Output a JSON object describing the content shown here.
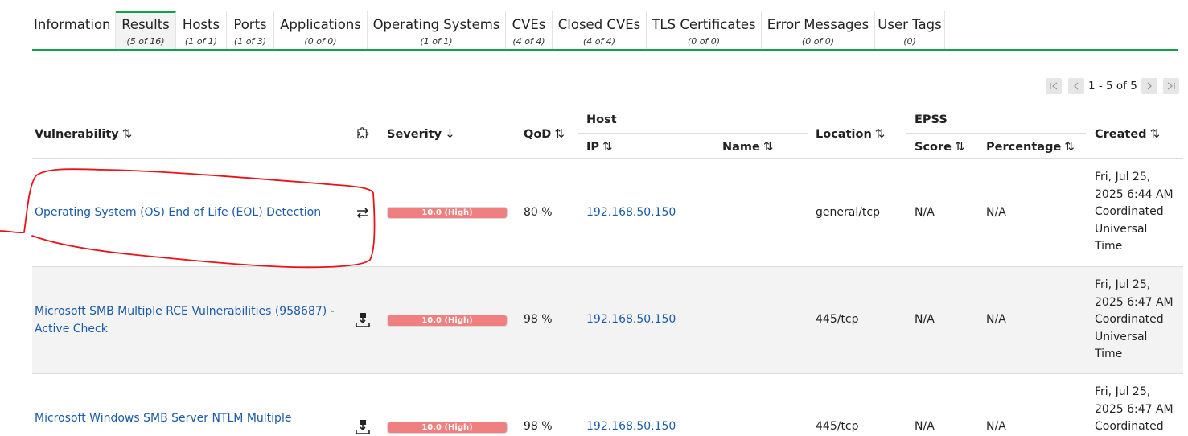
{
  "tabs": [
    {
      "label": "Information",
      "count": ""
    },
    {
      "label": "Results",
      "count": "(5 of 16)"
    },
    {
      "label": "Hosts",
      "count": "(1 of 1)"
    },
    {
      "label": "Ports",
      "count": "(1 of 3)"
    },
    {
      "label": "Applications",
      "count": "(0 of 0)"
    },
    {
      "label": "Operating Systems",
      "count": "(1 of 1)"
    },
    {
      "label": "CVEs",
      "count": "(4 of 4)"
    },
    {
      "label": "Closed CVEs",
      "count": "(4 of 4)"
    },
    {
      "label": "TLS Certificates",
      "count": "(0 of 0)"
    },
    {
      "label": "Error Messages",
      "count": "(0 of 0)"
    },
    {
      "label": "User Tags",
      "count": "(0)"
    }
  ],
  "pager": {
    "text": "1 - 5 of 5"
  },
  "headers": {
    "vulnerability": "Vulnerability",
    "severity": "Severity",
    "qod": "QoD",
    "host": "Host",
    "ip": "IP",
    "name": "Name",
    "location": "Location",
    "epss": "EPSS",
    "score": "Score",
    "percentage": "Percentage",
    "created": "Created",
    "sort_both": "⇅",
    "sort_down": "↓"
  },
  "rows": [
    {
      "vuln_line1": "Operating System (OS) End of Life (EOL) Detection",
      "vuln_line2": "",
      "solution_icon": "workaround-icon",
      "severity": "10.0 (High)",
      "qod": "80 %",
      "ip": "192.168.50.150",
      "name": "",
      "location": "general/tcp",
      "score": "N/A",
      "percentage": "N/A",
      "created": [
        "Fri, Jul 25,",
        "2025 6:44 AM",
        "Coordinated",
        "Universal",
        "Time"
      ]
    },
    {
      "vuln_line1": "Microsoft SMB Multiple RCE Vulnerabilities (958687) -",
      "vuln_line2": "Active Check",
      "solution_icon": "vendor-fix-icon",
      "severity": "10.0 (High)",
      "qod": "98 %",
      "ip": "192.168.50.150",
      "name": "",
      "location": "445/tcp",
      "score": "N/A",
      "percentage": "N/A",
      "created": [
        "Fri, Jul 25,",
        "2025 6:47 AM",
        "Coordinated",
        "Universal",
        "Time"
      ]
    },
    {
      "vuln_line1": "Microsoft Windows SMB Server NTLM Multiple",
      "vuln_line2": "",
      "solution_icon": "vendor-fix-icon",
      "severity": "10.0 (High)",
      "qod": "98 %",
      "ip": "192.168.50.150",
      "name": "",
      "location": "445/tcp",
      "score": "N/A",
      "percentage": "N/A",
      "created": [
        "Fri, Jul 25,",
        "2025 6:47 AM",
        "Coordinated",
        "",
        ""
      ]
    }
  ],
  "colors": {
    "accent": "#11a14c",
    "link": "#1a5aa7",
    "severity_high": "#f08080",
    "annotation": "#e8141b"
  }
}
